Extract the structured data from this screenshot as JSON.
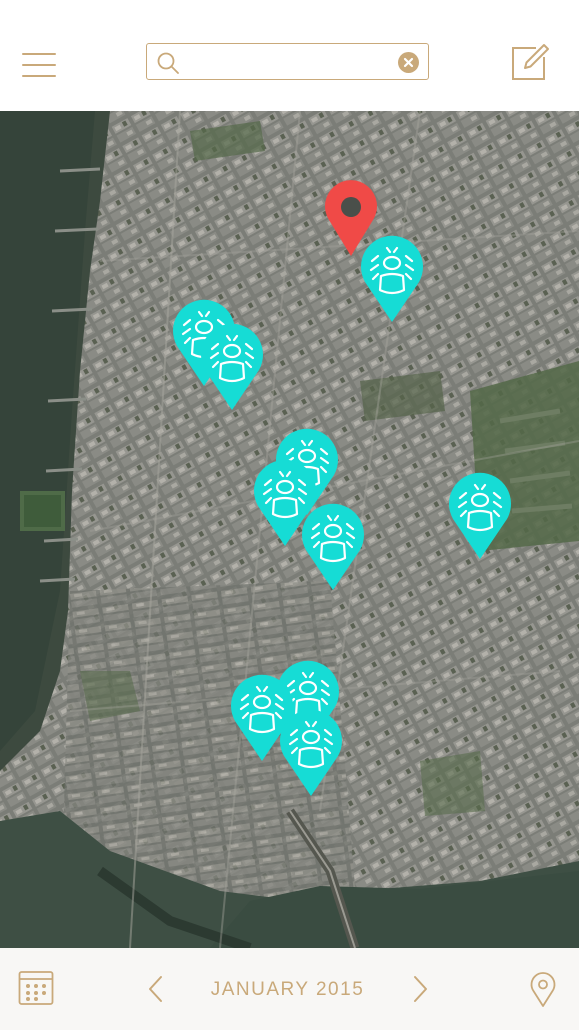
{
  "header": {
    "menu_icon": "hamburger-menu-icon",
    "search": {
      "value": "",
      "placeholder": "",
      "icon": "search-icon",
      "clear_icon": "clear-circle-x-icon"
    },
    "compose_icon": "compose-edit-icon"
  },
  "map": {
    "current_location_pin": {
      "icon": "map-pin-icon",
      "color": "#f04a47"
    },
    "marker_icon": "person-alert-marker-icon",
    "marker_color": "#16dcd5",
    "marker_count": 11
  },
  "footer": {
    "calendar_icon": "calendar-grid-icon",
    "prev_icon": "chevron-left-icon",
    "month_label": "JANUARY 2015",
    "next_icon": "chevron-right-icon",
    "location_icon": "location-pin-outline-icon"
  },
  "colors": {
    "accent": "#c9a97a",
    "header_bg": "#ffffff",
    "footer_bg": "#f8f7f4"
  }
}
